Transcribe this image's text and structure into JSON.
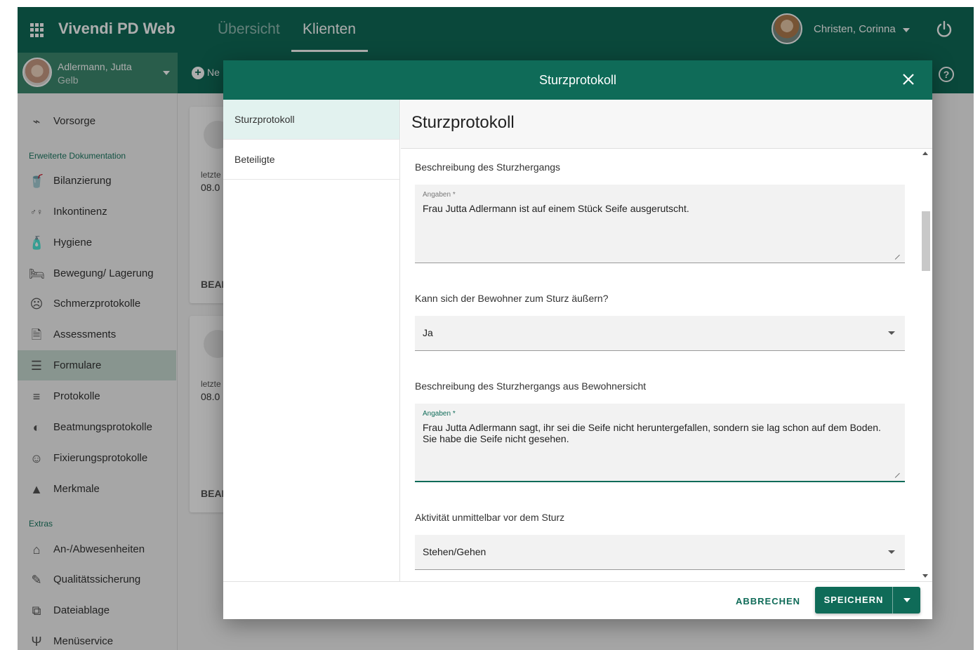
{
  "header": {
    "app_title": "Vivendi PD Web",
    "tabs": [
      {
        "label": "Übersicht",
        "active": false
      },
      {
        "label": "Klienten",
        "active": true
      }
    ],
    "user_name": "Christen, Corinna"
  },
  "client": {
    "name": "Adlermann, Jutta",
    "sub": "Gelb"
  },
  "toolbar": {
    "new_label": "Ne"
  },
  "sidebar": {
    "items_top": [
      {
        "label": "Vorsorge",
        "icon": "heart-monitor-icon"
      }
    ],
    "section_erweitert": "Erweiterte Dokumentation",
    "items_erweitert": [
      {
        "label": "Bilanzierung",
        "icon": "drink-icon"
      },
      {
        "label": "Inkontinenz",
        "icon": "incontinence-icon"
      },
      {
        "label": "Hygiene",
        "icon": "soap-icon"
      },
      {
        "label": "Bewegung/ Lagerung",
        "icon": "bed-icon"
      },
      {
        "label": "Schmerzprotokolle",
        "icon": "sad-face-icon"
      },
      {
        "label": "Assessments",
        "icon": "document-icon"
      },
      {
        "label": "Formulare",
        "icon": "form-icon",
        "active": true
      },
      {
        "label": "Protokolle",
        "icon": "checklist-icon"
      },
      {
        "label": "Beatmungsprotokolle",
        "icon": "ventilation-icon"
      },
      {
        "label": "Fixierungsprotokolle",
        "icon": "restraint-icon"
      },
      {
        "label": "Merkmale",
        "icon": "warning-icon"
      }
    ],
    "section_extras": "Extras",
    "items_extras": [
      {
        "label": "An-/Abwesenheiten",
        "icon": "presence-icon"
      },
      {
        "label": "Qualitätssicherung",
        "icon": "edit-check-icon"
      },
      {
        "label": "Dateiablage",
        "icon": "files-icon"
      },
      {
        "label": "Menüservice",
        "icon": "cutlery-icon"
      }
    ]
  },
  "background_cards": [
    {
      "label": "letzte",
      "date": "08.0",
      "action": "BEAI"
    },
    {
      "label": "letzte",
      "date": "08.0",
      "action": "BEAI"
    }
  ],
  "dialog": {
    "title": "Sturzprotokoll",
    "nav": [
      {
        "label": "Sturzprotokoll",
        "active": true
      },
      {
        "label": "Beteiligte",
        "active": false
      }
    ],
    "content_title": "Sturzprotokoll",
    "fields": {
      "f1_label": "Beschreibung des Sturzhergangs",
      "f1_small": "Angaben *",
      "f1_value": "Frau Jutta Adlermann ist auf einem Stück Seife ausgerutscht.",
      "f2_label": "Kann sich der Bewohner zum Sturz äußern?",
      "f2_value": "Ja",
      "f3_label": "Beschreibung des Sturzhergangs aus Bewohnersicht",
      "f3_small": "Angaben *",
      "f3_value": "Frau Jutta Adlermann sagt, ihr sei die Seife nicht heruntergefallen, sondern sie lag schon auf dem Boden.\nSie habe die Seife nicht gesehen.",
      "f4_label": "Aktivität unmittelbar vor dem Sturz",
      "f4_value": "Stehen/Gehen"
    },
    "cancel_label": "ABBRECHEN",
    "save_label": "SPEICHERN"
  },
  "colors": {
    "primary": "#0f6b58",
    "chip": "#3d8a6f",
    "active_sidebar": "#c9dcd3",
    "active_nav": "#e2f2ef"
  }
}
